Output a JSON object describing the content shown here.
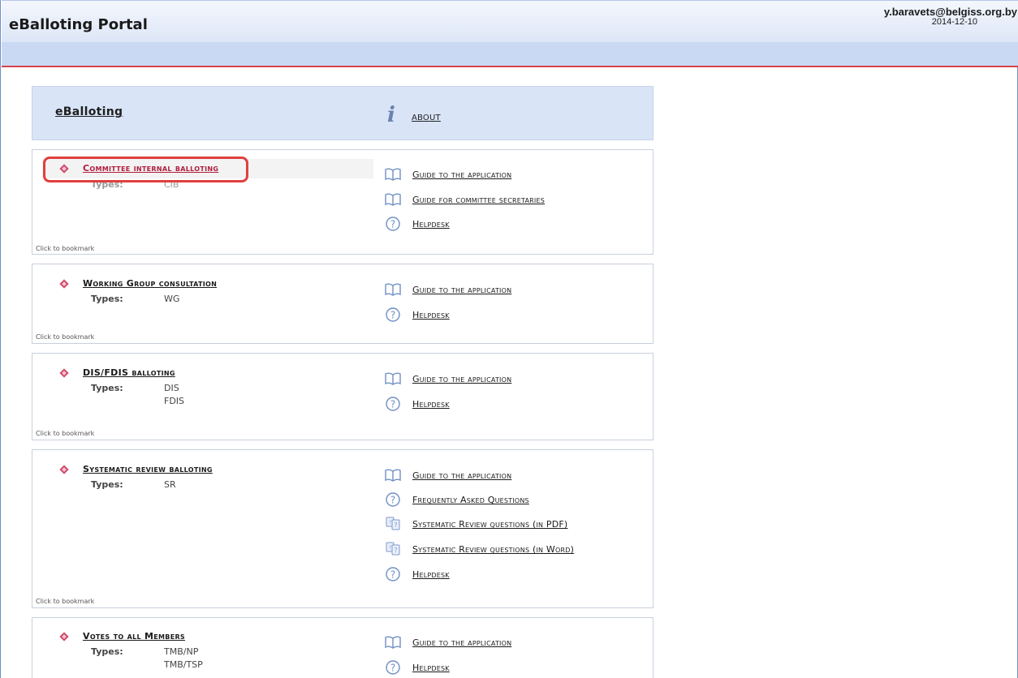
{
  "header": {
    "app_title": "eBalloting Portal",
    "user_email": "y.baravets@belgiss.org.by",
    "date": "2014-12-10"
  },
  "panel_header": {
    "title": "eBalloting",
    "about_label": "About"
  },
  "sections": [
    {
      "title": "Committee internal balloting",
      "types_label": "Types:",
      "types": [
        "CIB"
      ],
      "bookmark": "Click to bookmark",
      "links": [
        {
          "icon": "book-icon",
          "label": "Guide to the application"
        },
        {
          "icon": "book-icon",
          "label": "Guide for committee secretaries"
        },
        {
          "icon": "help-icon",
          "label": "Helpdesk"
        }
      ]
    },
    {
      "title": "Working Group consultation",
      "types_label": "Types:",
      "types": [
        "WG"
      ],
      "bookmark": "Click to bookmark",
      "links": [
        {
          "icon": "book-icon",
          "label": "Guide to the application"
        },
        {
          "icon": "help-icon",
          "label": "Helpdesk"
        }
      ]
    },
    {
      "title": "DIS/FDIS balloting",
      "types_label": "Types:",
      "types": [
        "DIS",
        "FDIS"
      ],
      "bookmark": "Click to bookmark",
      "links": [
        {
          "icon": "book-icon",
          "label": "Guide to the application"
        },
        {
          "icon": "help-icon",
          "label": "Helpdesk"
        }
      ]
    },
    {
      "title": "Systematic review balloting",
      "types_label": "Types:",
      "types": [
        "SR"
      ],
      "bookmark": "Click to bookmark",
      "links": [
        {
          "icon": "book-icon",
          "label": "Guide to the application"
        },
        {
          "icon": "help-icon",
          "label": "Frequently Asked Questions"
        },
        {
          "icon": "faq-document-icon",
          "label": "Systematic Review questions (in PDF)"
        },
        {
          "icon": "faq-document-icon",
          "label": "Systematic Review questions (in Word)"
        },
        {
          "icon": "help-icon",
          "label": "Helpdesk"
        }
      ]
    },
    {
      "title": "Votes to all Members",
      "types_label": "Types:",
      "types": [
        "TMB/NP",
        "TMB/TSP"
      ],
      "bookmark": "",
      "links": [
        {
          "icon": "book-icon",
          "label": "Guide to the application"
        },
        {
          "icon": "help-icon",
          "label": "Helpdesk"
        }
      ]
    }
  ],
  "colors": {
    "accent_red": "#d8424f",
    "header_blue": "#d9e4f7",
    "subbar_blue": "#c9d9f4",
    "active_title": "#b01c3c",
    "highlight_box": "#e0403e"
  }
}
